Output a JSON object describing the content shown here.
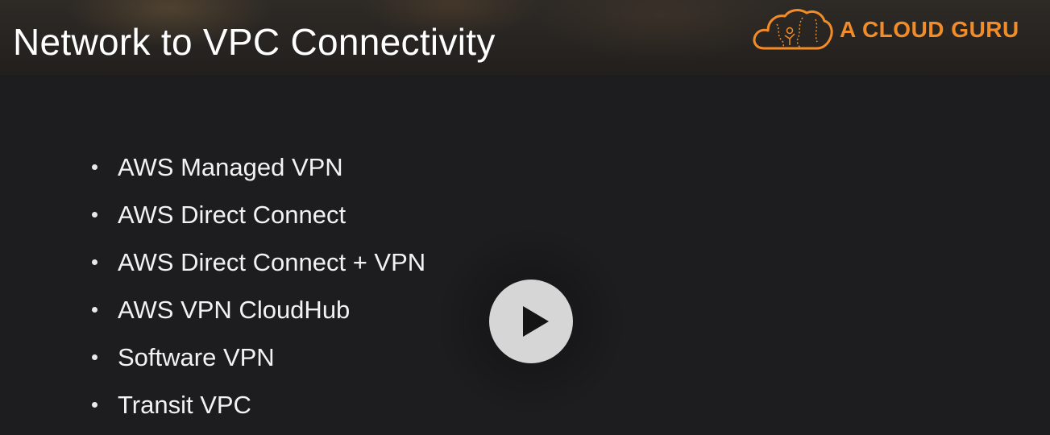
{
  "slide": {
    "title": "Network to VPC Connectivity"
  },
  "logo": {
    "text": "A CLOUD GURU",
    "icon": "cloud-icon",
    "color": "#f28c28"
  },
  "bullets": [
    "AWS Managed VPN",
    "AWS Direct Connect",
    "AWS Direct Connect + VPN",
    "AWS VPN CloudHub",
    "Software VPN",
    "Transit VPC"
  ],
  "player": {
    "icon": "play-icon",
    "button_color": "#d6d6d6"
  },
  "colors": {
    "background": "#1d1c1f",
    "text": "#f2f2f2",
    "accent": "#f28c28"
  }
}
